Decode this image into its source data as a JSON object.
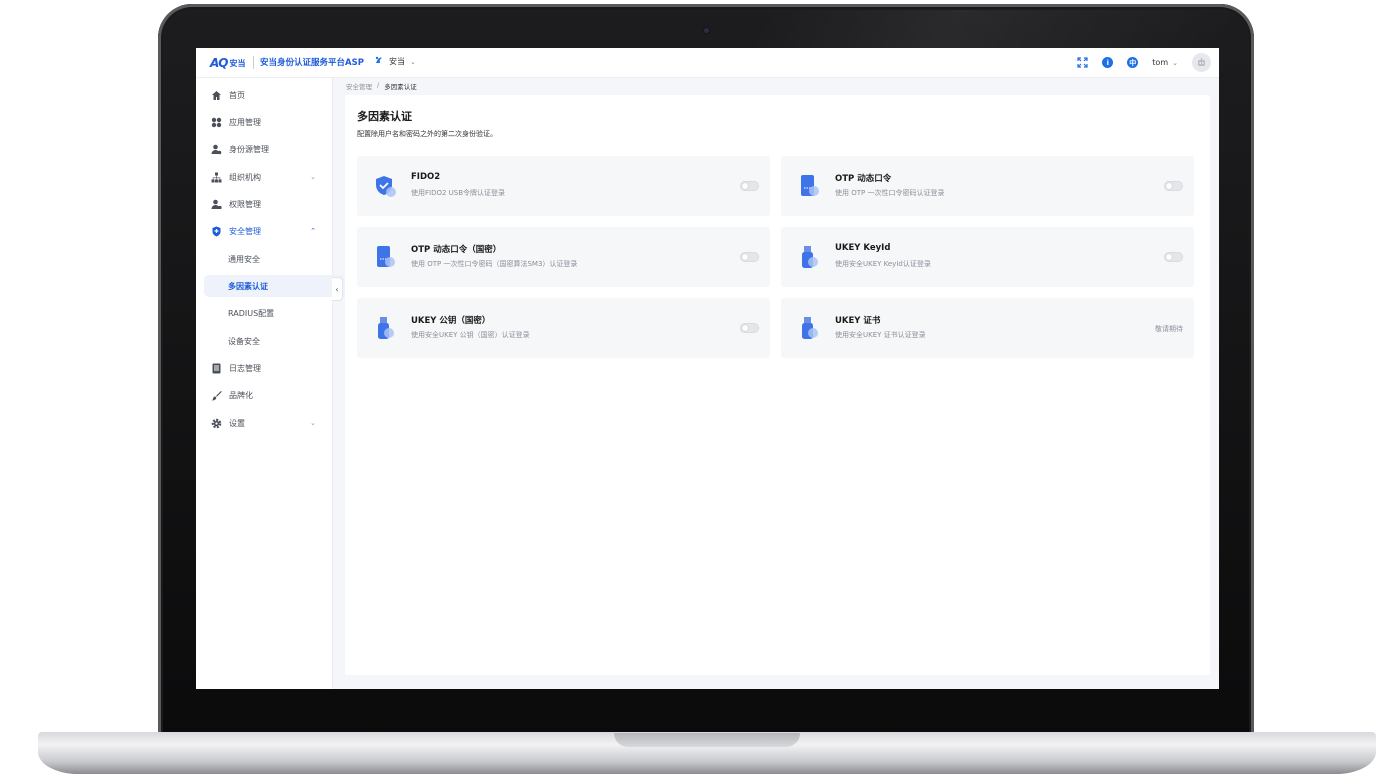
{
  "header": {
    "logo_mark": "AQ",
    "logo_text": "安当",
    "app_title": "安当身份认证服务平台ASP",
    "tenant": "安当",
    "user": "tom",
    "lang": "中",
    "info": "i"
  },
  "sidebar": {
    "items": [
      {
        "label": "首页"
      },
      {
        "label": "应用管理"
      },
      {
        "label": "身份源管理"
      },
      {
        "label": "组织机构"
      },
      {
        "label": "权限管理"
      },
      {
        "label": "安全管理"
      },
      {
        "label": "通用安全"
      },
      {
        "label": "多因素认证"
      },
      {
        "label": "RADIUS配置"
      },
      {
        "label": "设备安全"
      },
      {
        "label": "日志管理"
      },
      {
        "label": "品牌化"
      },
      {
        "label": "设置"
      }
    ]
  },
  "breadcrumb": {
    "parent": "安全管理",
    "separator": "/",
    "current": "多因素认证"
  },
  "page": {
    "title": "多因素认证",
    "description": "配置除用户名和密码之外的第二次身份验证。"
  },
  "cards": [
    {
      "title": "FIDO2",
      "desc": "使用FIDO2 USB令牌认证登录",
      "enabled": false
    },
    {
      "title": "OTP 动态口令",
      "desc": "使用 OTP 一次性口令密码认证登录",
      "enabled": false
    },
    {
      "title": "OTP 动态口令（国密）",
      "desc": "使用 OTP 一次性口令密码（国密算法SM3）认证登录",
      "enabled": false
    },
    {
      "title": "UKEY KeyId",
      "desc": "使用安全UKEY KeyId认证登录",
      "enabled": false
    },
    {
      "title": "UKEY 公钥（国密）",
      "desc": "使用安全UKEY 公钥（国密）认证登录",
      "enabled": false
    },
    {
      "title": "UKEY 证书",
      "desc": "使用安全UKEY 证书认证登录",
      "status": "敬请期待"
    }
  ],
  "colors": {
    "brand": "#1e5bd8",
    "accent": "#1e6ee8",
    "card_bg": "#f6f7f9",
    "selected_bg": "#eef3fb"
  }
}
